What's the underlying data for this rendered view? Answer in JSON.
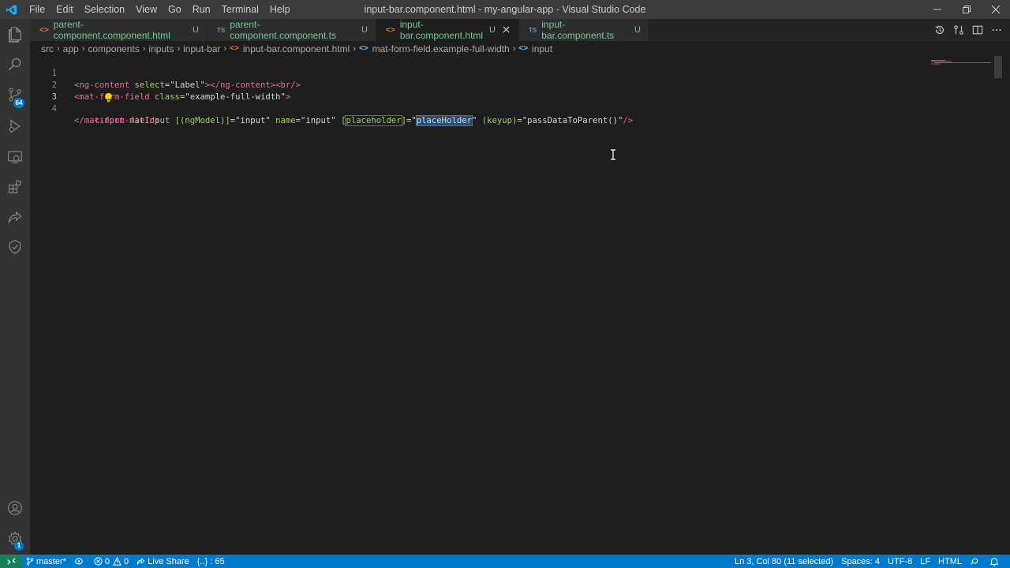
{
  "window": {
    "title": "input-bar.component.html - my-angular-app - Visual Studio Code"
  },
  "menu": [
    "File",
    "Edit",
    "Selection",
    "View",
    "Go",
    "Run",
    "Terminal",
    "Help"
  ],
  "activity_bar": {
    "source_control_badge": "64",
    "settings_badge": "1"
  },
  "tabs": [
    {
      "icon": "<>",
      "name": "parent-component.component.html",
      "status": "U",
      "active": false
    },
    {
      "icon": "TS",
      "name": "parent-component.component.ts",
      "status": "U",
      "active": false
    },
    {
      "icon": "<>",
      "name": "input-bar.component.html",
      "status": "U",
      "active": true
    },
    {
      "icon": "TS",
      "name": "input-bar.component.ts",
      "status": "U",
      "active": false
    }
  ],
  "breadcrumb": {
    "parts": [
      "src",
      "app",
      "components",
      "inputs",
      "input-bar"
    ],
    "file": "input-bar.component.html",
    "element": "mat-form-field.example-full-width",
    "leaf": "input"
  },
  "editor": {
    "line_numbers": [
      "1",
      "2",
      "3",
      "4"
    ],
    "line1": {
      "open": "<ng-content",
      "attr": " select",
      "eq": "=",
      "val": "\"Label\"",
      "close": "></ng-content><br/>"
    },
    "line2": {
      "open": "<mat-form-field",
      "attr": " class",
      "eq": "=",
      "val": "\"example-full-width\"",
      "close": ">"
    },
    "line3": {
      "indent": "    ",
      "open": "<input",
      "attr1": " matInput",
      "attr2": " [(ngModel)]",
      "v2": "=\"input\"",
      "attr3": " name",
      "v3": "=\"input\"",
      "attr4_pre": " [",
      "attr4": "placeholder",
      "attr4_post": "]",
      "v4_pre": "=\"",
      "v4_sel": "placeHolder",
      "v4_post": "\"",
      "attr5": " (keyup)",
      "v5": "=\"passDataToParent()\"",
      "close": "/>"
    },
    "line4": {
      "close": "</mat-form-field>"
    }
  },
  "status_bar": {
    "branch": "master*",
    "errors": "0",
    "warnings": "0",
    "live_share": "Live Share",
    "symbol": "{..} : 65",
    "position": "Ln 3, Col 80 (11 selected)",
    "spaces": "Spaces: 4",
    "encoding": "UTF-8",
    "eol": "LF",
    "language": "HTML"
  },
  "colors": {
    "status_bar": "#007acc",
    "activity_bar": "#333333",
    "editor_bg": "#1e1e1e",
    "untracked": "#73c991"
  }
}
